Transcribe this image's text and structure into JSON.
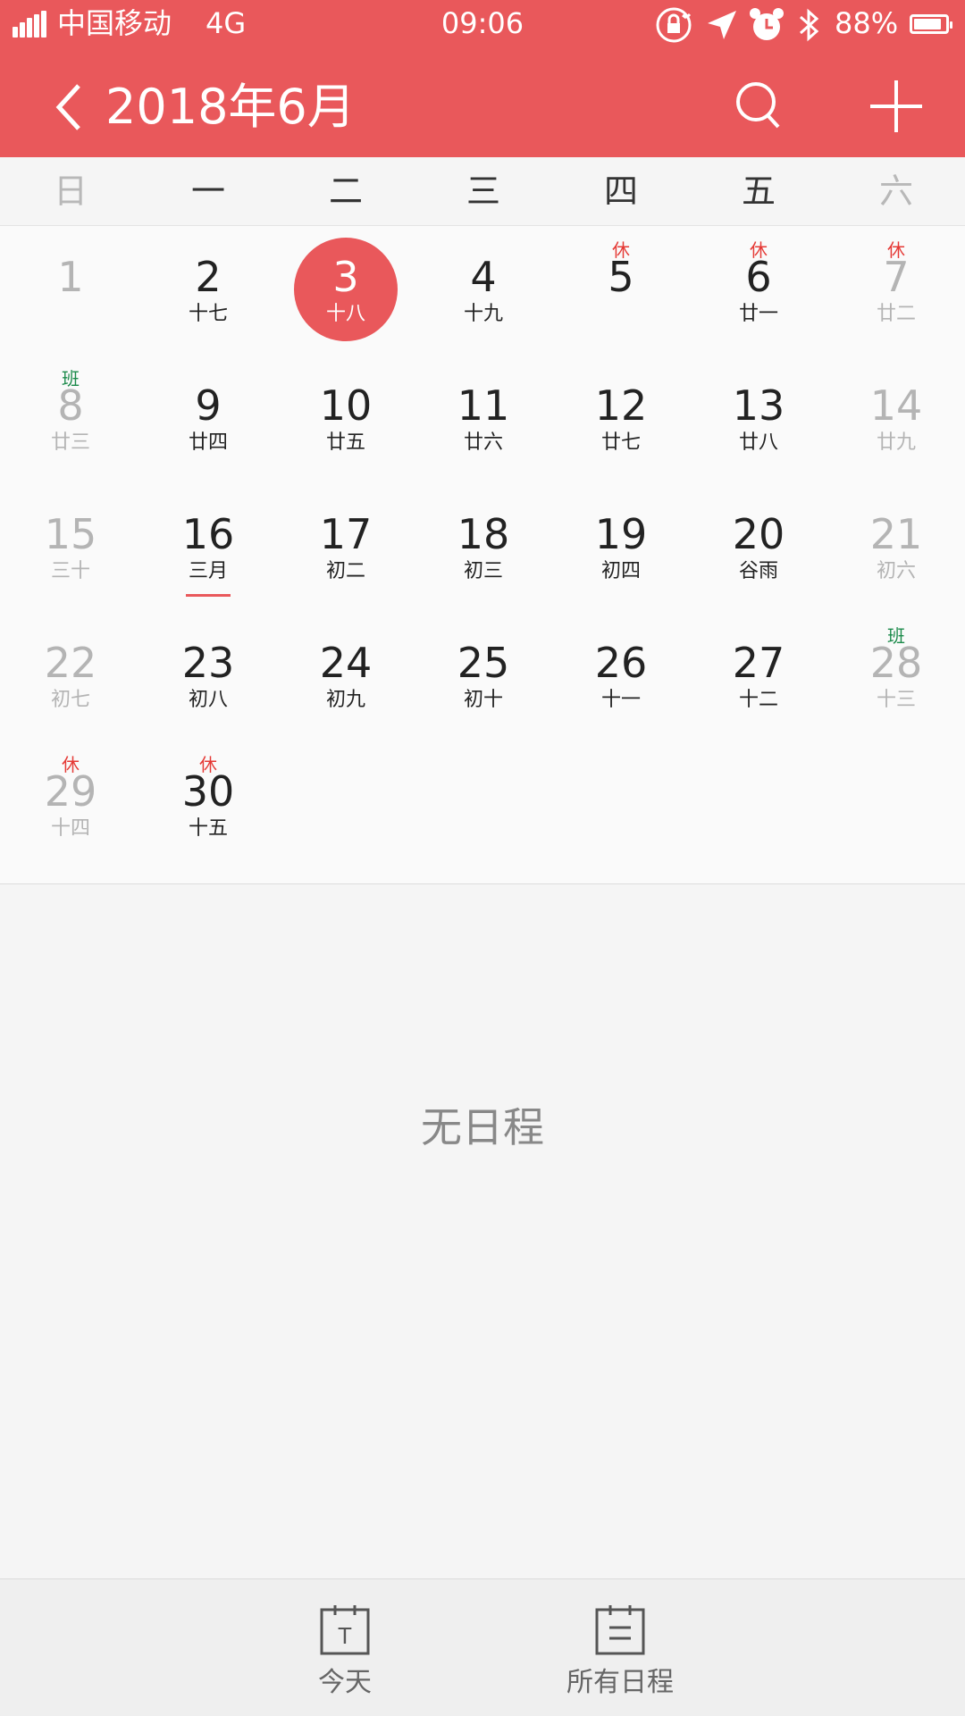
{
  "status_bar": {
    "carrier": "中国移动",
    "network": "4G",
    "time": "09:06",
    "battery_percent": "88%",
    "battery_level": 0.88,
    "icons": [
      "signal-icon",
      "rotation-lock-icon",
      "location-icon",
      "alarm-icon",
      "bluetooth-icon",
      "battery-icon"
    ]
  },
  "header": {
    "title": "2018年6月",
    "back_icon": "chevron-left-icon",
    "search_icon": "search-icon",
    "add_icon": "plus-icon"
  },
  "weekdays": [
    "日",
    "一",
    "二",
    "三",
    "四",
    "五",
    "六"
  ],
  "calendar": {
    "days": [
      {
        "day": "1",
        "lunar": "",
        "badge": "",
        "muted": true
      },
      {
        "day": "2",
        "lunar": "十七",
        "badge": ""
      },
      {
        "day": "3",
        "lunar": "十八",
        "badge": "",
        "today": true
      },
      {
        "day": "4",
        "lunar": "十九",
        "badge": ""
      },
      {
        "day": "5",
        "lunar": "",
        "badge": "休",
        "badge_type": "rest"
      },
      {
        "day": "6",
        "lunar": "廿一",
        "badge": "休",
        "badge_type": "rest"
      },
      {
        "day": "7",
        "lunar": "廿二",
        "badge": "休",
        "badge_type": "rest",
        "muted": true
      },
      {
        "day": "8",
        "lunar": "廿三",
        "badge": "班",
        "badge_type": "work",
        "muted": true
      },
      {
        "day": "9",
        "lunar": "廿四",
        "badge": ""
      },
      {
        "day": "10",
        "lunar": "廿五",
        "badge": ""
      },
      {
        "day": "11",
        "lunar": "廿六",
        "badge": ""
      },
      {
        "day": "12",
        "lunar": "廿七",
        "badge": ""
      },
      {
        "day": "13",
        "lunar": "廿八",
        "badge": ""
      },
      {
        "day": "14",
        "lunar": "廿九",
        "badge": "",
        "muted": true
      },
      {
        "day": "15",
        "lunar": "三十",
        "badge": "",
        "muted": true
      },
      {
        "day": "16",
        "lunar": "三月",
        "badge": "",
        "underline": true
      },
      {
        "day": "17",
        "lunar": "初二",
        "badge": ""
      },
      {
        "day": "18",
        "lunar": "初三",
        "badge": ""
      },
      {
        "day": "19",
        "lunar": "初四",
        "badge": ""
      },
      {
        "day": "20",
        "lunar": "谷雨",
        "badge": ""
      },
      {
        "day": "21",
        "lunar": "初六",
        "badge": "",
        "muted": true
      },
      {
        "day": "22",
        "lunar": "初七",
        "badge": "",
        "muted": true
      },
      {
        "day": "23",
        "lunar": "初八",
        "badge": ""
      },
      {
        "day": "24",
        "lunar": "初九",
        "badge": ""
      },
      {
        "day": "25",
        "lunar": "初十",
        "badge": ""
      },
      {
        "day": "26",
        "lunar": "十一",
        "badge": ""
      },
      {
        "day": "27",
        "lunar": "十二",
        "badge": ""
      },
      {
        "day": "28",
        "lunar": "十三",
        "badge": "班",
        "badge_type": "work",
        "muted": true
      },
      {
        "day": "29",
        "lunar": "十四",
        "badge": "休",
        "badge_type": "rest",
        "muted": true
      },
      {
        "day": "30",
        "lunar": "十五",
        "badge": "休",
        "badge_type": "rest"
      }
    ]
  },
  "colors": {
    "accent": "#e9585b",
    "rest_badge": "#e53935",
    "work_badge": "#1b8a4a",
    "muted": "#b4b4b4"
  },
  "empty_state": "无日程",
  "bottom_nav": {
    "today": {
      "label": "今天",
      "icon": "calendar-today-icon",
      "glyph": "T"
    },
    "all": {
      "label": "所有日程",
      "icon": "schedule-list-icon"
    }
  }
}
